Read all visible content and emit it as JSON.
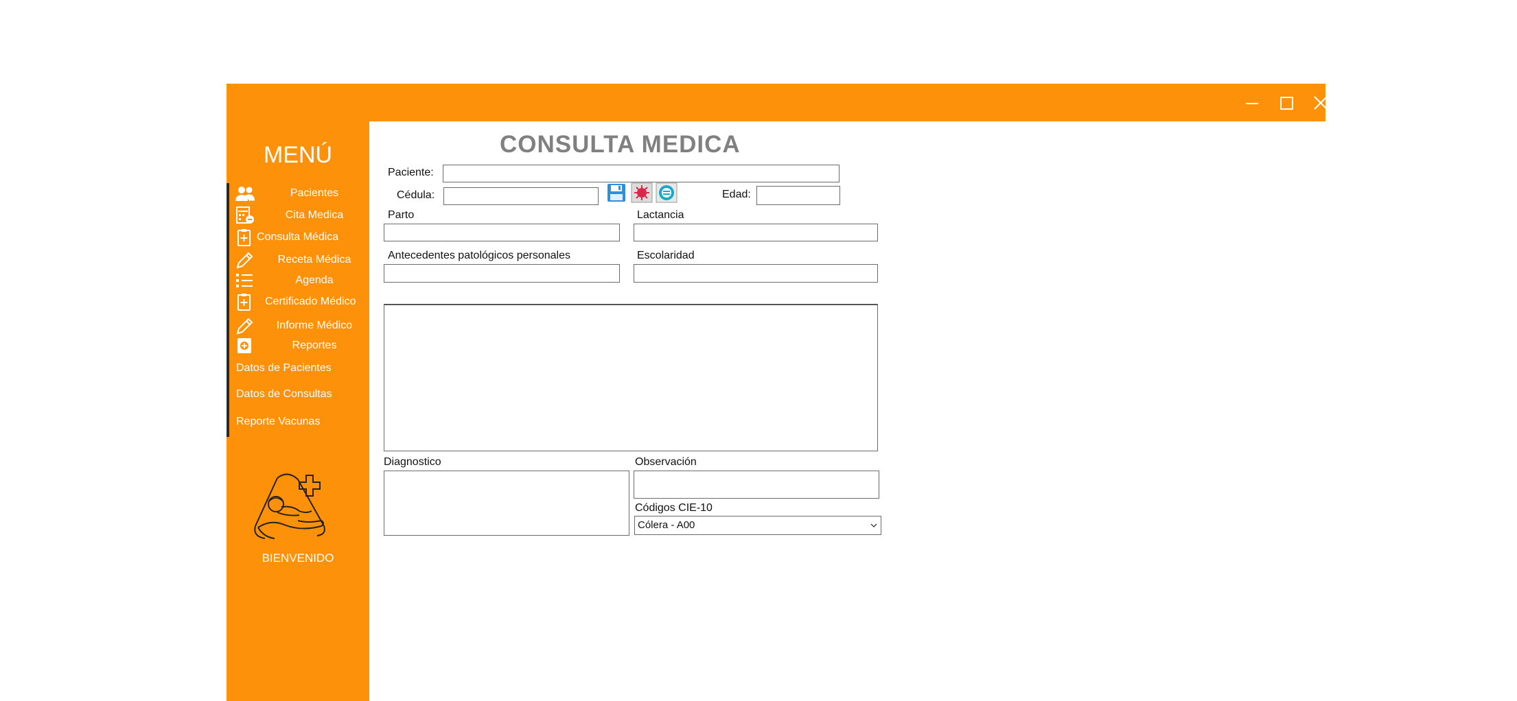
{
  "window": {
    "controls": {
      "minimize": "minimize-icon",
      "maximize": "maximize-icon",
      "close": "close-icon"
    },
    "accent_color": "#fd910a"
  },
  "sidebar": {
    "menu_title": "MENÚ",
    "items": [
      {
        "label": "Pacientes",
        "icon": "users-icon"
      },
      {
        "label": "Cita Medica",
        "icon": "calculator-icon"
      },
      {
        "label": "Consulta Médica",
        "icon": "clipboard-plus-icon"
      },
      {
        "label": "Receta Médica",
        "icon": "pencil-icon"
      },
      {
        "label": "Agenda",
        "icon": "list-icon"
      },
      {
        "label": "Certificado Médico",
        "icon": "clipboard-plus-icon"
      },
      {
        "label": "Informe Médico",
        "icon": "pencil-icon"
      },
      {
        "label": "Reportes",
        "icon": "report-icon"
      }
    ],
    "sub_items": [
      {
        "label": "Datos de Pacientes"
      },
      {
        "label": "Datos de Consultas"
      },
      {
        "label": "Reporte Vacunas"
      }
    ],
    "logo": "baby-care-logo",
    "welcome": "BIENVENIDO"
  },
  "form": {
    "title": "CONSULTA MEDICA",
    "paciente_label": "Paciente:",
    "paciente_value": "",
    "cedula_label": "Cédula:",
    "cedula_value": "",
    "edad_label": "Edad:",
    "edad_value": "",
    "toolbar": {
      "save_icon": "save-icon",
      "virus_icon": "virus-icon",
      "search_icon": "search-icon"
    },
    "parto_label": "Parto",
    "parto_value": "",
    "lactancia_label": "Lactancia",
    "lactancia_value": "",
    "antecedentes_label": "Antecedentes patológicos personales",
    "antecedentes_value": "",
    "escolaridad_label": "Escolaridad",
    "escolaridad_value": "",
    "notes_value": "",
    "diagnostico_label": "Diagnostico",
    "diagnostico_value": "",
    "observacion_label": "Observación",
    "observacion_value": "",
    "cie10_label": "Códigos CIE-10",
    "cie10_selected": "Cólera - A00"
  }
}
